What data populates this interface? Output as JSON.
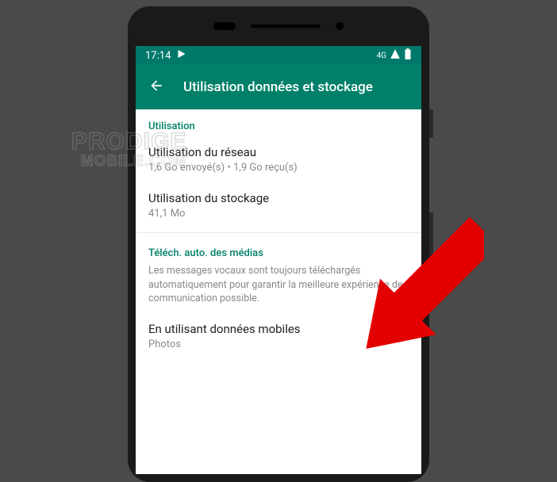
{
  "status_bar": {
    "time": "17:14",
    "network_label": "4G"
  },
  "app_bar": {
    "title": "Utilisation données et stockage"
  },
  "sections": {
    "usage": {
      "header": "Utilisation",
      "network_usage": {
        "title": "Utilisation du réseau",
        "subtitle": "1,6 Go envoyé(s) • 1,9 Go reçu(s)"
      },
      "storage_usage": {
        "title": "Utilisation du stockage",
        "subtitle": "41,1 Mo"
      }
    },
    "media_download": {
      "header": "Téléch. auto. des médias",
      "description": "Les messages vocaux sont toujours téléchargés automatiquement pour garantir la meilleure expérience de communication possible.",
      "mobile_data": {
        "title": "En utilisant données mobiles",
        "subtitle": "Photos"
      }
    }
  },
  "watermark": {
    "line1": "PRODIGE",
    "line2": "MOBILE.COM"
  }
}
